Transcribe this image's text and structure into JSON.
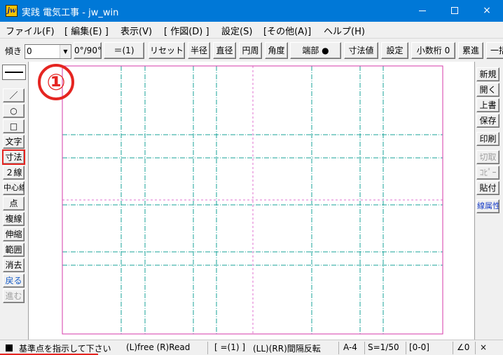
{
  "window": {
    "title": "実践 電気工事 - jw_win",
    "app_icon_text": "jw",
    "buttons": {
      "minimize": "minimize-icon",
      "maximize": "maximize-icon",
      "close": "×"
    }
  },
  "menu": [
    "ファイル(F)",
    "[ 編集(E) ]",
    "表示(V)",
    "[ 作図(D) ]",
    "設定(S)",
    "[その他(A)]",
    "ヘルプ(H)"
  ],
  "toolbar": {
    "angle_label": "傾き",
    "angle_value": "0",
    "combo_arrow": "▼",
    "buttons": [
      "0°/90°",
      "＝(1)",
      "リセット",
      "半径",
      "直径",
      "円周",
      "角度",
      "端部 ●",
      "寸法値",
      "設定",
      "小数桁 0",
      "累進",
      "一括"
    ]
  },
  "left_tools": {
    "step_marker": "①",
    "items": [
      {
        "label": "／",
        "style": "normal"
      },
      {
        "label": "○",
        "style": "normal"
      },
      {
        "label": "□",
        "style": "normal"
      },
      {
        "label": "文字",
        "style": "normal"
      },
      {
        "label": "寸法",
        "style": "active"
      },
      {
        "label": "２線",
        "style": "normal"
      },
      {
        "label": "中心線",
        "style": "normal"
      },
      {
        "label": "点",
        "style": "normal"
      },
      {
        "label": "複線",
        "style": "normal"
      },
      {
        "label": "伸縮",
        "style": "normal"
      },
      {
        "label": "範囲",
        "style": "normal"
      },
      {
        "label": "消去",
        "style": "normal"
      },
      {
        "label": "戻る",
        "style": "blue"
      },
      {
        "label": "進む",
        "style": "disabled"
      }
    ]
  },
  "right_tools": [
    {
      "label": "新規",
      "style": "normal"
    },
    {
      "label": "開く",
      "style": "normal"
    },
    {
      "label": "上書",
      "style": "normal"
    },
    {
      "label": "保存",
      "style": "normal"
    },
    {
      "label": "印刷",
      "style": "normal"
    },
    {
      "label": "切取",
      "style": "disabled"
    },
    {
      "label": "ｺﾋﾟｰ",
      "style": "disabled"
    },
    {
      "label": "貼付",
      "style": "normal"
    },
    {
      "label": "線属性",
      "style": "blue"
    }
  ],
  "status": {
    "message": "基準点を指示して下さい",
    "mouse_hint": "(L)free (R)Read",
    "dim_mode": "[ =(1) ]",
    "double_click": "(LL)(RR)間隔反転",
    "paper_size": "A-4",
    "scale": "S=1/50",
    "layer": "[0-0]",
    "angle": "∠0",
    "close_mark": "×"
  },
  "colors": {
    "title_bar": "#0078d7",
    "paper_frame": "#d63aa8",
    "grid_line": "#1aa39a",
    "center_line": "#e070d0",
    "highlight": "#e52521"
  }
}
